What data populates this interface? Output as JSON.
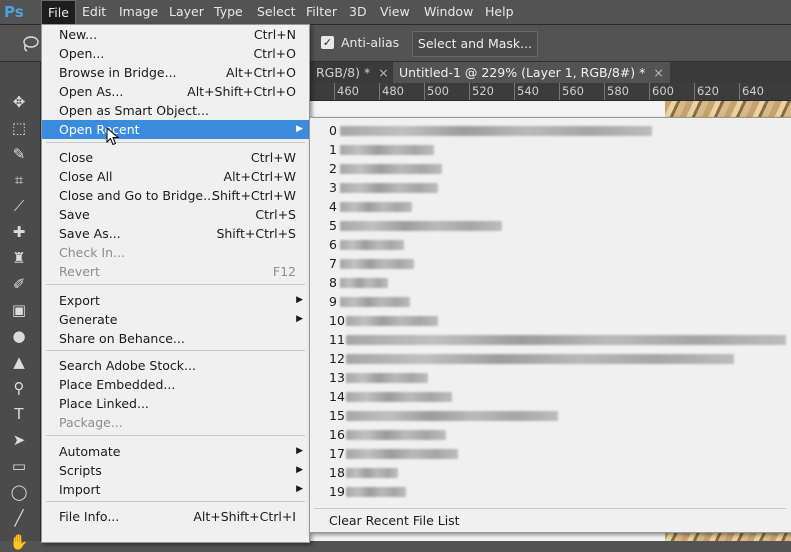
{
  "app": {
    "logo": "Ps"
  },
  "menubar": [
    {
      "label": "File",
      "active": true
    },
    {
      "label": "Edit"
    },
    {
      "label": "Image"
    },
    {
      "label": "Layer"
    },
    {
      "label": "Type"
    },
    {
      "label": "Select"
    },
    {
      "label": "Filter"
    },
    {
      "label": "3D"
    },
    {
      "label": "View"
    },
    {
      "label": "Window"
    },
    {
      "label": "Help"
    }
  ],
  "options": {
    "anti_alias_label": "Anti-alias",
    "anti_alias_checked": true,
    "select_mask_label": "Select and Mask..."
  },
  "tabs": [
    {
      "label": "RGB/8) *",
      "close": "×",
      "active": false
    },
    {
      "label": "Untitled-1 @ 229% (Layer 1, RGB/8#) *",
      "close": "×",
      "active": true
    }
  ],
  "ruler": [
    "460",
    "480",
    "500",
    "520",
    "540",
    "560",
    "580",
    "600",
    "620",
    "640"
  ],
  "file_menu": {
    "items": [
      {
        "label": "New...",
        "shortcut": "Ctrl+N"
      },
      {
        "label": "Open...",
        "shortcut": "Ctrl+O"
      },
      {
        "label": "Browse in Bridge...",
        "shortcut": "Alt+Ctrl+O"
      },
      {
        "label": "Open As...",
        "shortcut": "Alt+Shift+Ctrl+O"
      },
      {
        "label": "Open as Smart Object...",
        "shortcut": ""
      },
      {
        "label": "Open Recent",
        "shortcut": "",
        "submenu": true,
        "highlight": true
      },
      {
        "label": "Close",
        "shortcut": "Ctrl+W"
      },
      {
        "label": "Close All",
        "shortcut": "Alt+Ctrl+W"
      },
      {
        "label": "Close and Go to Bridge...",
        "shortcut": "Shift+Ctrl+W"
      },
      {
        "label": "Save",
        "shortcut": "Ctrl+S"
      },
      {
        "label": "Save As...",
        "shortcut": "Shift+Ctrl+S"
      },
      {
        "label": "Check In...",
        "shortcut": "",
        "disabled": true
      },
      {
        "label": "Revert",
        "shortcut": "F12",
        "disabled": true
      },
      {
        "label": "Export",
        "shortcut": "",
        "submenu": true
      },
      {
        "label": "Generate",
        "shortcut": "",
        "submenu": true
      },
      {
        "label": "Share on Behance...",
        "shortcut": ""
      },
      {
        "label": "Search Adobe Stock...",
        "shortcut": ""
      },
      {
        "label": "Place Embedded...",
        "shortcut": ""
      },
      {
        "label": "Place Linked...",
        "shortcut": ""
      },
      {
        "label": "Package...",
        "shortcut": "",
        "disabled": true
      },
      {
        "label": "Automate",
        "shortcut": "",
        "submenu": true
      },
      {
        "label": "Scripts",
        "shortcut": "",
        "submenu": true
      },
      {
        "label": "Import",
        "shortcut": "",
        "submenu": true
      },
      {
        "label": "File Info...",
        "shortcut": "Alt+Shift+Ctrl+I"
      }
    ]
  },
  "recent_menu": {
    "numbers": [
      "0",
      "1",
      "2",
      "3",
      "4",
      "5",
      "6",
      "7",
      "8",
      "9",
      "10",
      "11",
      "12",
      "13",
      "14",
      "15",
      "16",
      "17",
      "18",
      "19"
    ],
    "clear_label": "Clear Recent File List"
  }
}
